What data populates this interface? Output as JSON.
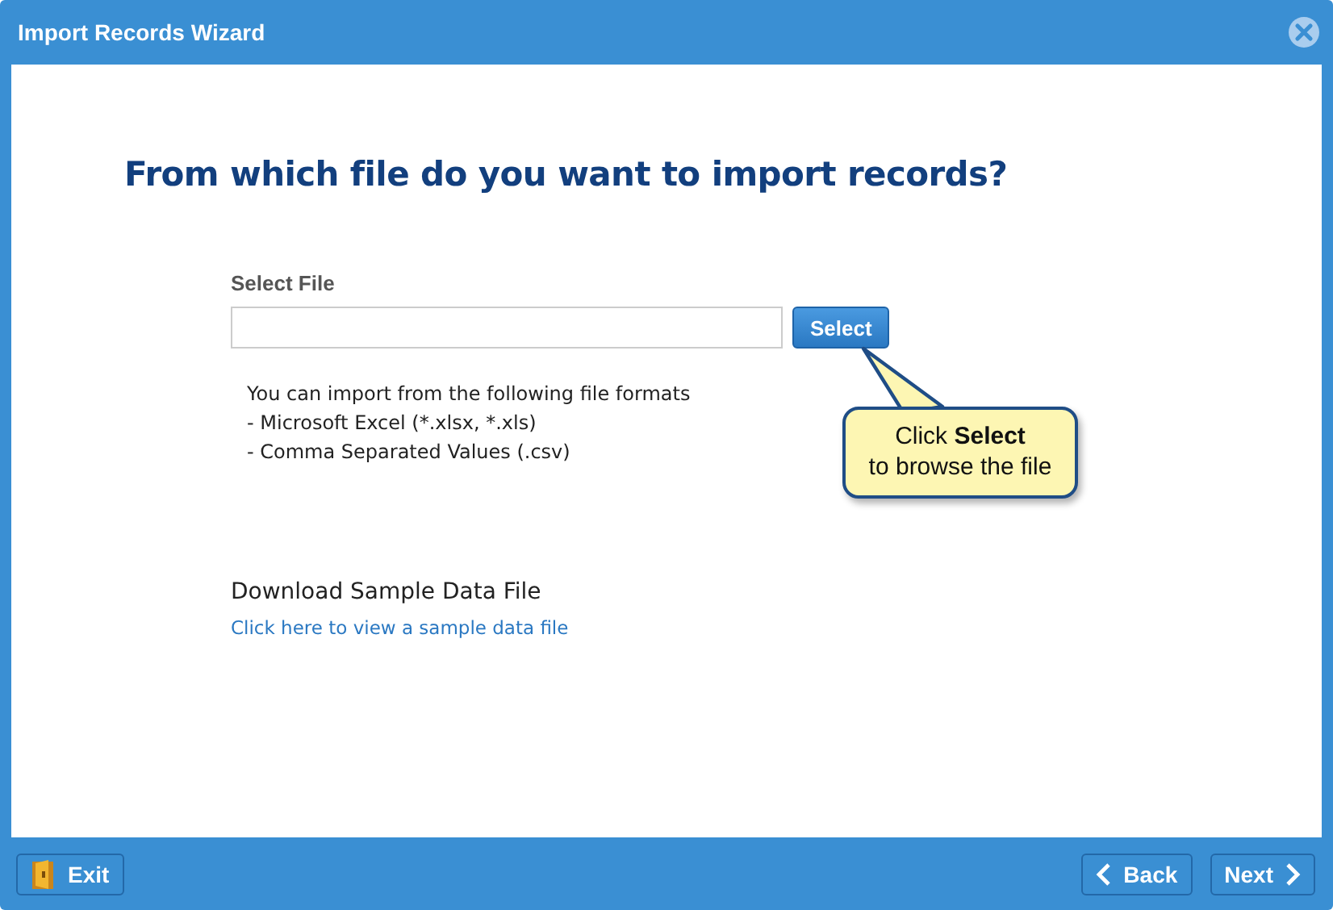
{
  "window": {
    "title": "Import Records Wizard"
  },
  "heading": "From which file do you want to import records?",
  "file_field": {
    "label": "Select File",
    "button": "Select"
  },
  "formats": {
    "intro": "You can import from the following file formats",
    "items": [
      "- Microsoft Excel (*.xlsx, *.xls)",
      "- Comma Separated Values (.csv)"
    ]
  },
  "callout": "Click **Select**\nto browse the file",
  "sample": {
    "title": "Download Sample Data File",
    "link": "Click here to view a sample data file"
  },
  "footer": {
    "exit": "Exit",
    "back": "Back",
    "next": "Next"
  }
}
